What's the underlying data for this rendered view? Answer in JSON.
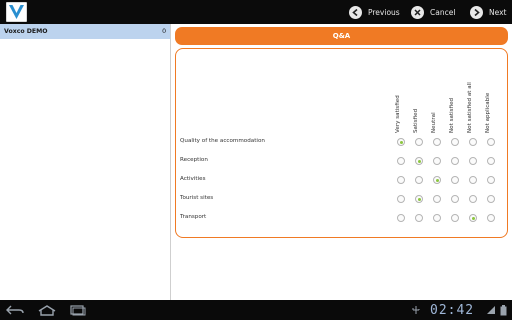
{
  "app": {
    "logo_letter": "V",
    "icons": {
      "logo": "vovox-logo-icon"
    }
  },
  "toolbar": {
    "previous_label": "Previous",
    "cancel_label": "Cancel",
    "next_label": "Next",
    "icons": {
      "previous": "arrow-left-circle-icon",
      "cancel": "close-circle-icon",
      "next": "arrow-right-circle-icon"
    }
  },
  "sidebar": {
    "items": [
      {
        "label": "Voxco DEMO",
        "count": "0",
        "selected": true
      }
    ]
  },
  "main": {
    "section_title": "Q&A",
    "columns": [
      "Very satisfied",
      "Satisfied",
      "Neutral",
      "Not satisfied",
      "Not satisfied at all",
      "Not applicable"
    ],
    "rows": [
      {
        "label": "Quality of the accommodation",
        "selected_index": 0
      },
      {
        "label": "Reception",
        "selected_index": 1
      },
      {
        "label": "Activities",
        "selected_index": 2
      },
      {
        "label": "Tourist sites",
        "selected_index": 1
      },
      {
        "label": "Transport",
        "selected_index": 4
      }
    ]
  },
  "system_bar": {
    "clock": "02:42",
    "icons": [
      "back-icon",
      "home-icon",
      "recent-apps-icon",
      "usb-debug-icon",
      "signal-icon",
      "battery-icon"
    ]
  },
  "colors": {
    "accent": "#f07a24",
    "selection": "#bcd3ee",
    "radio_selected": "#8cc63f",
    "top_bar": "#0b0b0b"
  }
}
